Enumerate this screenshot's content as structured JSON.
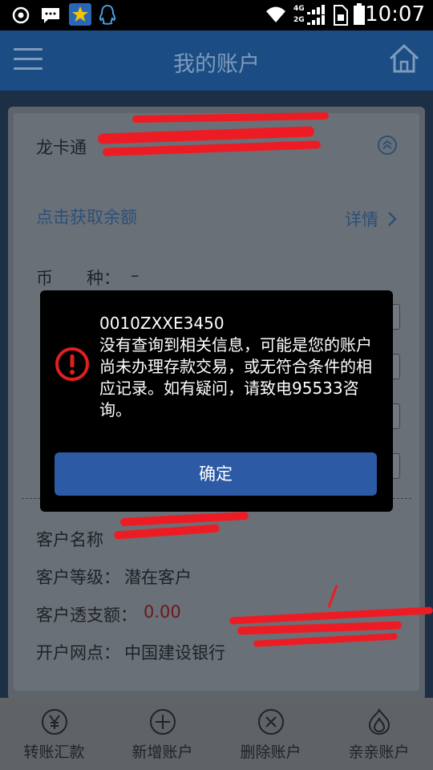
{
  "status_bar": {
    "time": "10:07",
    "network_top": "4G",
    "network_bottom": "2G"
  },
  "header": {
    "title": "我的账户"
  },
  "account": {
    "card_label": "龙卡通",
    "balance_link": "点击获取余额",
    "details_link": "详情",
    "currency_label": "币　　种：",
    "currency_value": "–",
    "customer_name_label": "客户名称",
    "customer_level_label": "客户等级：",
    "customer_level_value": "潜在客户",
    "overdraft_label": "客户透支额：",
    "overdraft_value": "0.00",
    "branch_label": "开户网点：",
    "branch_value": "中国建设银行"
  },
  "dialog": {
    "code": "0010ZXXE3450",
    "message": "没有查询到相关信息，可能是您的账户尚未办理存款交易，或无符合条件的相应记录。如有疑问，请致电95533咨询。",
    "ok_label": "确定"
  },
  "tabs": [
    {
      "label": "转账汇款",
      "icon": "yen-circle-icon"
    },
    {
      "label": "新增账户",
      "icon": "plus-circle-icon"
    },
    {
      "label": "删除账户",
      "icon": "x-circle-icon"
    },
    {
      "label": "亲亲账户",
      "icon": "flame-icon"
    }
  ],
  "colors": {
    "nav": "#1b4d84",
    "dialog_button": "#2c5aa4",
    "overdraft_value": "#e02020",
    "redaction": "#ed1c24"
  }
}
